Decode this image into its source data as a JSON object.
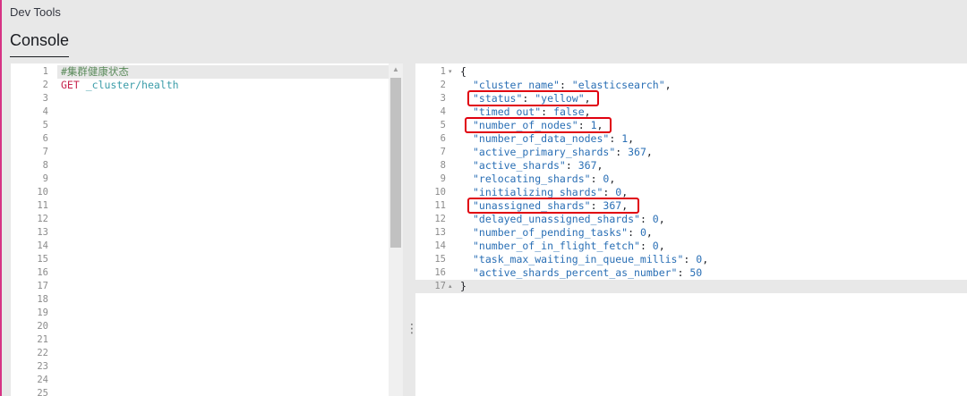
{
  "app_title": "Dev Tools",
  "tabs": [
    {
      "label": "Console"
    }
  ],
  "request_editor": {
    "lines": [
      {
        "num": "1",
        "comment": "#集群健康状态"
      },
      {
        "num": "2",
        "method": "GET",
        "url": "_cluster/health"
      },
      {
        "num": "3"
      },
      {
        "num": "4"
      },
      {
        "num": "5"
      },
      {
        "num": "6"
      },
      {
        "num": "7"
      },
      {
        "num": "8"
      },
      {
        "num": "9"
      },
      {
        "num": "10"
      },
      {
        "num": "11"
      },
      {
        "num": "12"
      },
      {
        "num": "13"
      },
      {
        "num": "14"
      },
      {
        "num": "15"
      },
      {
        "num": "16"
      },
      {
        "num": "17"
      },
      {
        "num": "18"
      },
      {
        "num": "19"
      },
      {
        "num": "20"
      },
      {
        "num": "21"
      },
      {
        "num": "22"
      },
      {
        "num": "23"
      },
      {
        "num": "24"
      },
      {
        "num": "25"
      }
    ]
  },
  "response_viewer": {
    "lines": [
      {
        "num": "1",
        "text": "{"
      },
      {
        "num": "2",
        "key": "\"cluster_name\"",
        "value": "\"elasticsearch\"",
        "tail": ","
      },
      {
        "num": "3",
        "key": "\"status\"",
        "value": "\"yellow\"",
        "tail": ","
      },
      {
        "num": "4",
        "key": "\"timed_out\"",
        "value": "false",
        "tail": ","
      },
      {
        "num": "5",
        "key": "\"number_of_nodes\"",
        "value": "1",
        "tail": ","
      },
      {
        "num": "6",
        "key": "\"number_of_data_nodes\"",
        "value": "1",
        "tail": ","
      },
      {
        "num": "7",
        "key": "\"active_primary_shards\"",
        "value": "367",
        "tail": ","
      },
      {
        "num": "8",
        "key": "\"active_shards\"",
        "value": "367",
        "tail": ","
      },
      {
        "num": "9",
        "key": "\"relocating_shards\"",
        "value": "0",
        "tail": ","
      },
      {
        "num": "10",
        "key": "\"initializing_shards\"",
        "value": "0",
        "tail": ","
      },
      {
        "num": "11",
        "key": "\"unassigned_shards\"",
        "value": "367",
        "tail": ","
      },
      {
        "num": "12",
        "key": "\"delayed_unassigned_shards\"",
        "value": "0",
        "tail": ","
      },
      {
        "num": "13",
        "key": "\"number_of_pending_tasks\"",
        "value": "0",
        "tail": ","
      },
      {
        "num": "14",
        "key": "\"number_of_in_flight_fetch\"",
        "value": "0",
        "tail": ","
      },
      {
        "num": "15",
        "key": "\"task_max_waiting_in_queue_millis\"",
        "value": "0",
        "tail": ","
      },
      {
        "num": "16",
        "key": "\"active_shards_percent_as_number\"",
        "value": "50",
        "tail": ""
      },
      {
        "num": "17",
        "text": "}"
      }
    ]
  },
  "colors": {
    "highlight_box": "#e0000f",
    "accent": "#d63384"
  }
}
